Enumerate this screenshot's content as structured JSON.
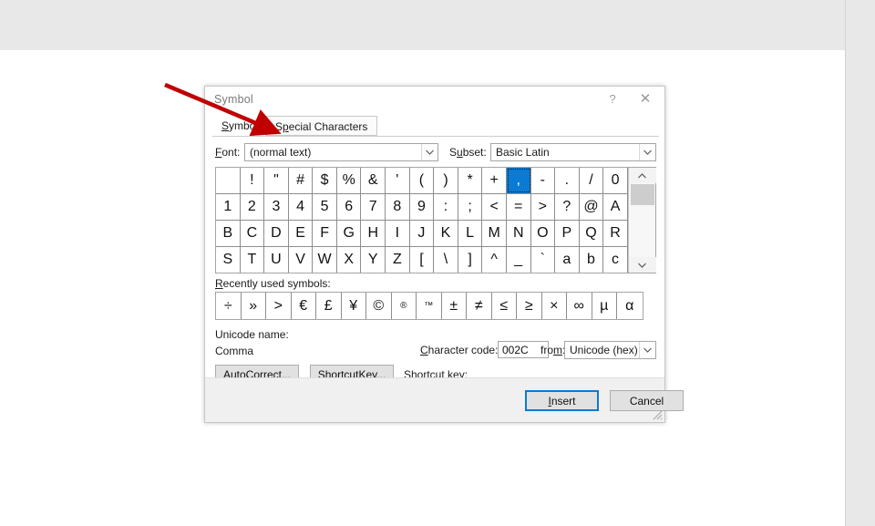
{
  "window": {
    "title": "Symbol",
    "help_icon": "question-mark-icon",
    "close_icon": "close-icon"
  },
  "tabs": [
    {
      "id": "symbols",
      "label": "Symbols",
      "active": true,
      "accesskey": "S"
    },
    {
      "id": "special-characters",
      "label": "Special Characters",
      "active": false,
      "accesskey": "p"
    }
  ],
  "font_row": {
    "font_label": "Font:",
    "font_value": "(normal text)",
    "subset_label": "Subset:",
    "subset_value": "Basic Latin"
  },
  "character_grid": {
    "columns": 17,
    "rows": [
      [
        " ",
        "!",
        "\"",
        "#",
        "$",
        "%",
        "&",
        "'",
        "(",
        ")",
        "*",
        "+",
        ",",
        "-",
        ".",
        "/",
        "0"
      ],
      [
        "1",
        "2",
        "3",
        "4",
        "5",
        "6",
        "7",
        "8",
        "9",
        ":",
        ";",
        "<",
        "=",
        ">",
        "?",
        "@",
        "A"
      ],
      [
        "B",
        "C",
        "D",
        "E",
        "F",
        "G",
        "H",
        "I",
        "J",
        "K",
        "L",
        "M",
        "N",
        "O",
        "P",
        "Q",
        "R"
      ],
      [
        "S",
        "T",
        "U",
        "V",
        "W",
        "X",
        "Y",
        "Z",
        "[",
        "\\",
        "]",
        "^",
        "_",
        "`",
        "a",
        "b",
        "c"
      ]
    ],
    "selected": {
      "row": 0,
      "col": 12,
      "char": ","
    },
    "selection_color": "#0a7ad4",
    "scrollbar": {
      "up_icon": "chevron-up-icon",
      "down_icon": "chevron-down-icon",
      "thumb_position": "top"
    }
  },
  "recent": {
    "label": "Recently used symbols:",
    "symbols": [
      "÷",
      "»",
      ">",
      "€",
      "£",
      "¥",
      "©",
      "®",
      "™",
      "±",
      "≠",
      "≤",
      "≥",
      "×",
      "∞",
      "µ",
      "α"
    ],
    "small_index": [
      7,
      8
    ]
  },
  "details": {
    "unicode_name_label": "Unicode name:",
    "unicode_name_value": "Comma",
    "charcode_label": "Character code:",
    "charcode_value": "002C",
    "from_label": "from:",
    "from_value": "Unicode (hex)"
  },
  "actions": {
    "autocorrect_label": "AutoCorrect...",
    "shortcutkey_label": "Shortcut Key...",
    "shortcut_key_label": "Shortcut key:",
    "insert_label": "Insert",
    "cancel_label": "Cancel"
  },
  "annotation": {
    "color": "#c00000",
    "arrow_name": "red-arrow-pointing-to-special-characters-tab",
    "rect_name": "red-highlight-rectangle-special-characters-tab"
  }
}
